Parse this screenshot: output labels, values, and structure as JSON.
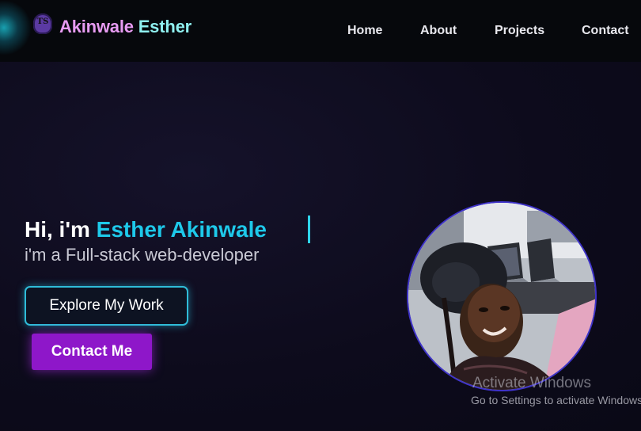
{
  "brand": {
    "logo_text": "TS",
    "first_name": "Akinwale",
    "last_name": "Esther"
  },
  "nav": {
    "items": [
      {
        "label": "Home"
      },
      {
        "label": "About"
      },
      {
        "label": "Projects"
      },
      {
        "label": "Contact"
      }
    ]
  },
  "hero": {
    "greeting_prefix": "Hi, i'm ",
    "greeting_name": "Esther Akinwale",
    "subtitle": "i'm a Full-stack web-developer",
    "primary_button": "Explore My Work",
    "secondary_button": "Contact Me"
  },
  "watermark": {
    "title": "Activate Windows",
    "subtitle": "Go to Settings to activate Windows."
  },
  "colors": {
    "background": "#0d0b1c",
    "navbar": "#06080c",
    "accent_cyan": "#1ec9ea",
    "brand_pink": "#e79bf2",
    "brand_cyan": "#8ff0f0",
    "button_purple": "#8e17c9"
  }
}
